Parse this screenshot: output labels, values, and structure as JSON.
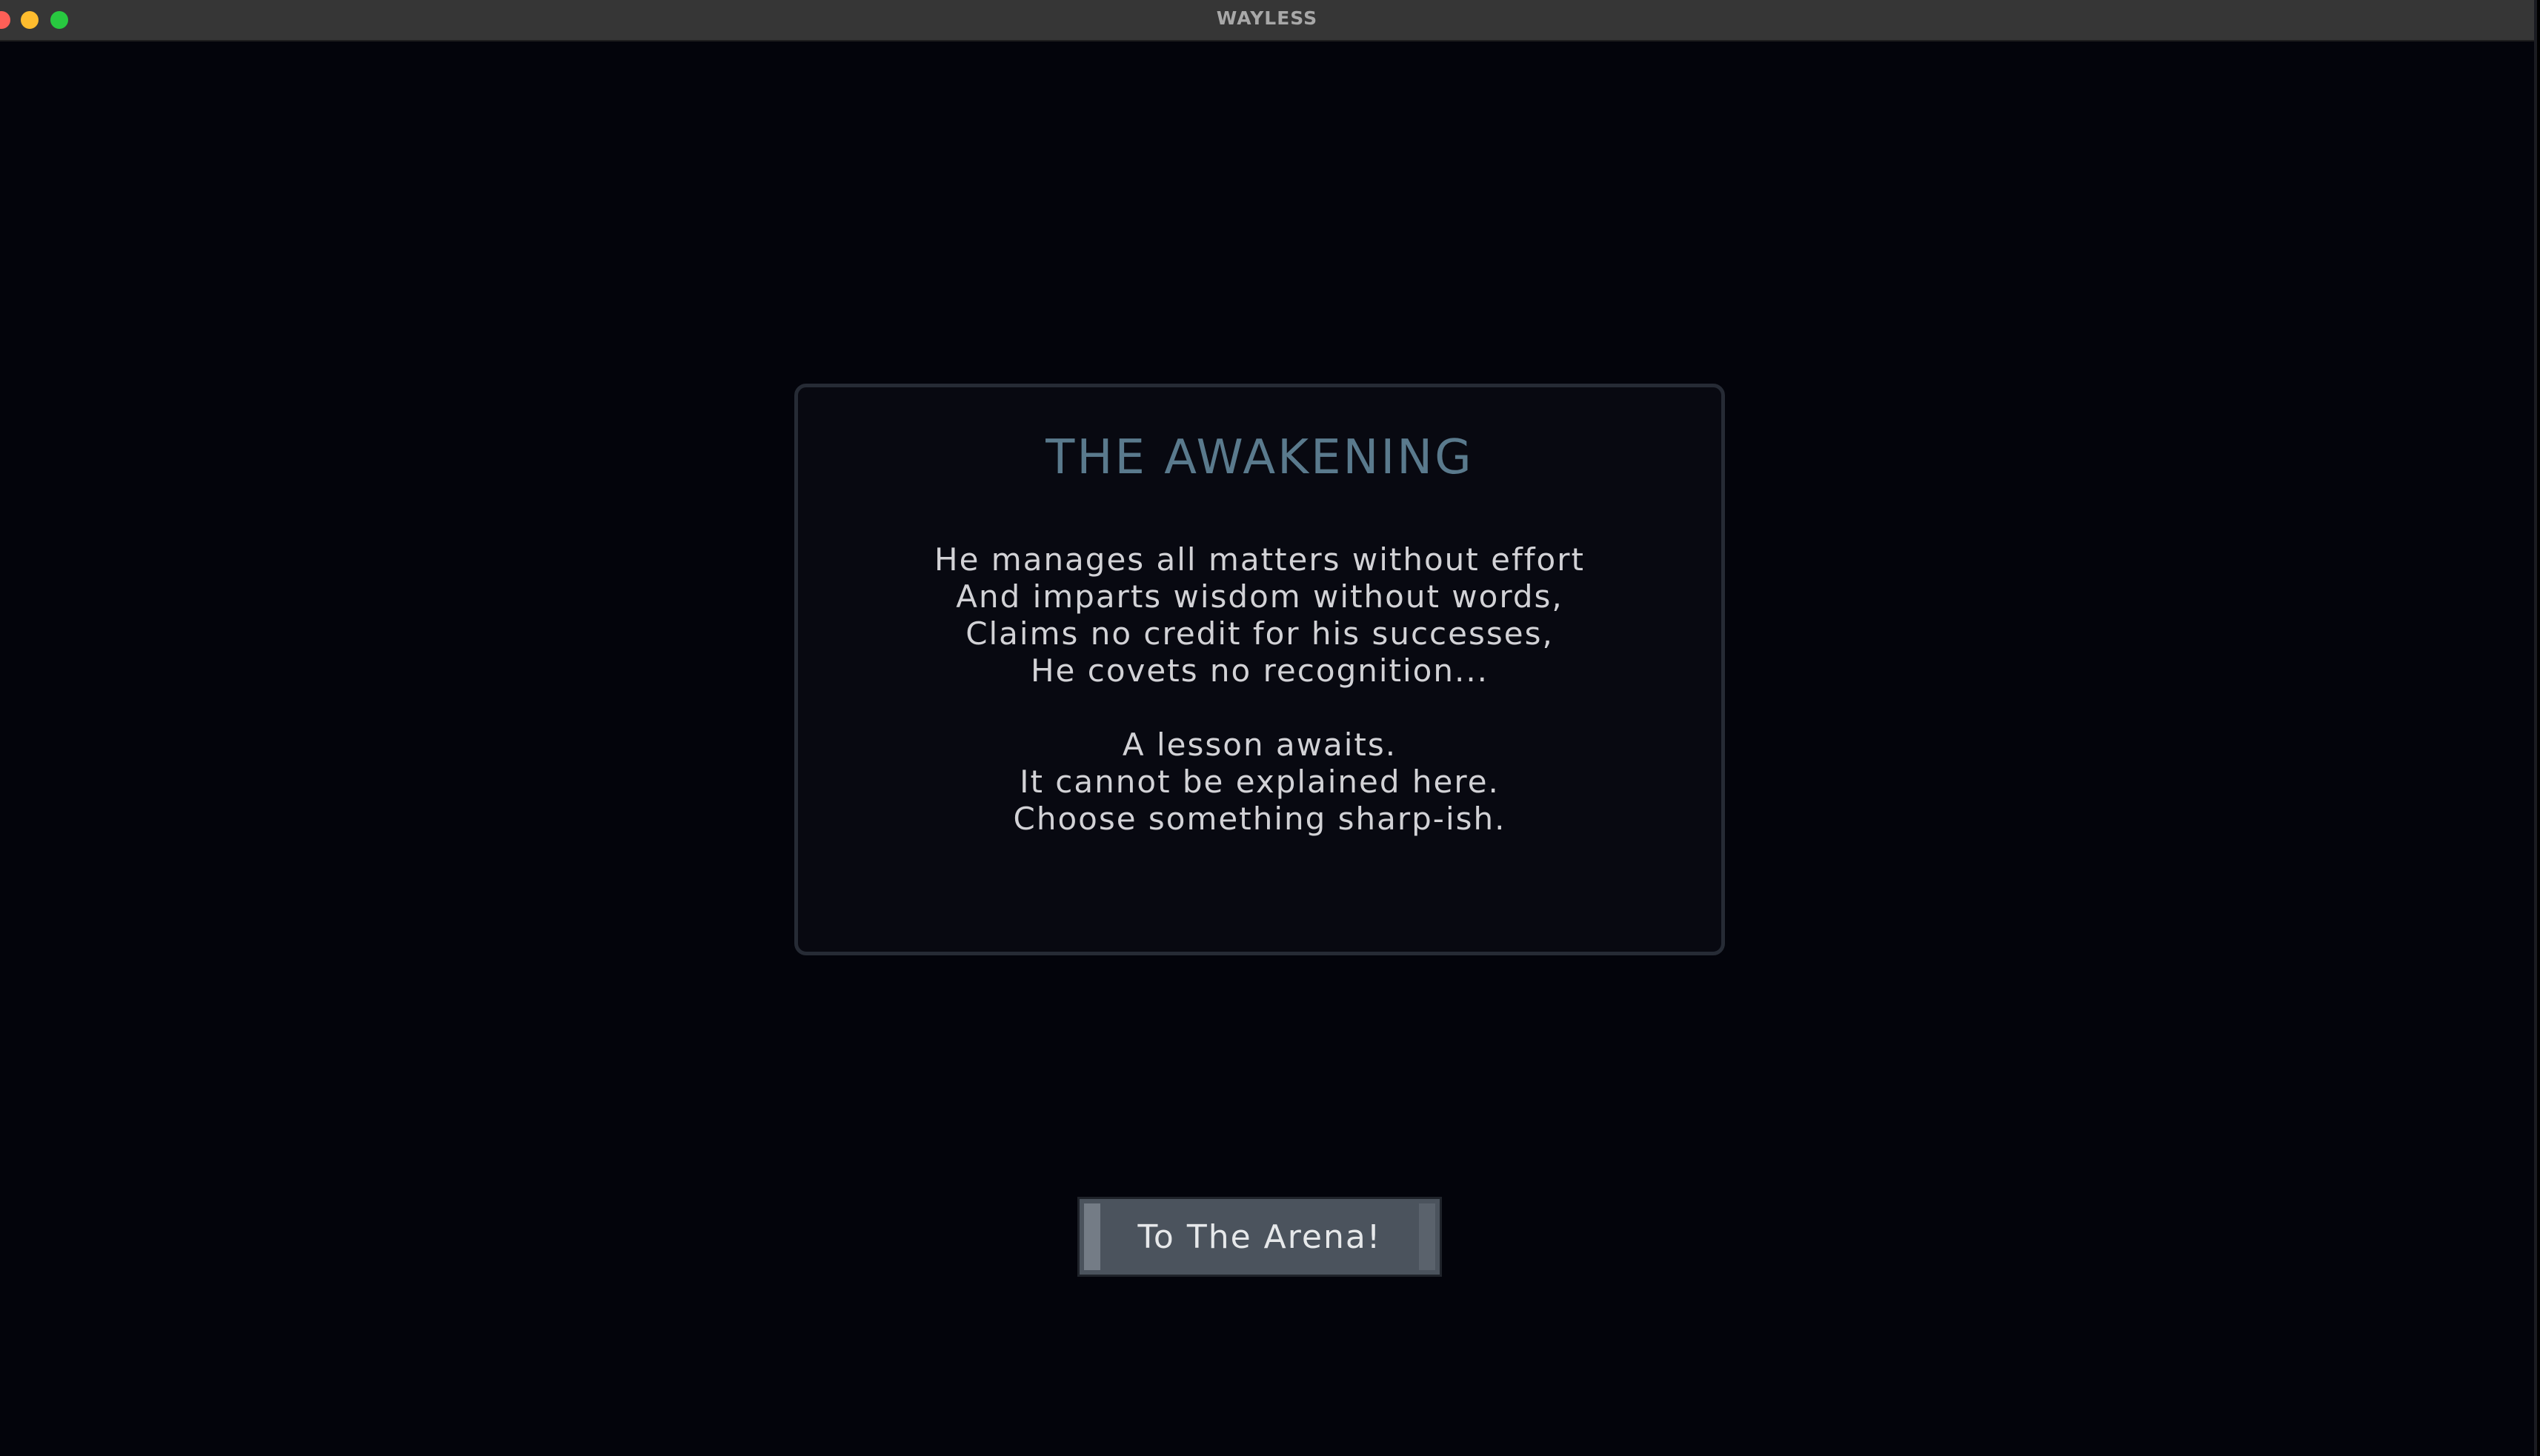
{
  "window": {
    "title": "WAYLESS"
  },
  "dialog": {
    "title": "THE AWAKENING",
    "poem_lines": [
      "He manages all matters without effort",
      "And imparts wisdom without words,",
      "Claims no credit for his successes,",
      "He covets no recognition..."
    ],
    "lesson_lines": [
      "A lesson awaits.",
      "It cannot be explained here.",
      "Choose something sharp-ish."
    ]
  },
  "actions": {
    "arena_button_label": "To The Arena!"
  },
  "colors": {
    "background": "#03040b",
    "panel_border": "#262b35",
    "title_accent": "#5a7a8d",
    "body_text": "#d2d2d6",
    "button_fill": "#4b535d"
  },
  "icons": {
    "close": "close-icon",
    "minimize": "minimize-icon",
    "maximize": "maximize-icon"
  }
}
